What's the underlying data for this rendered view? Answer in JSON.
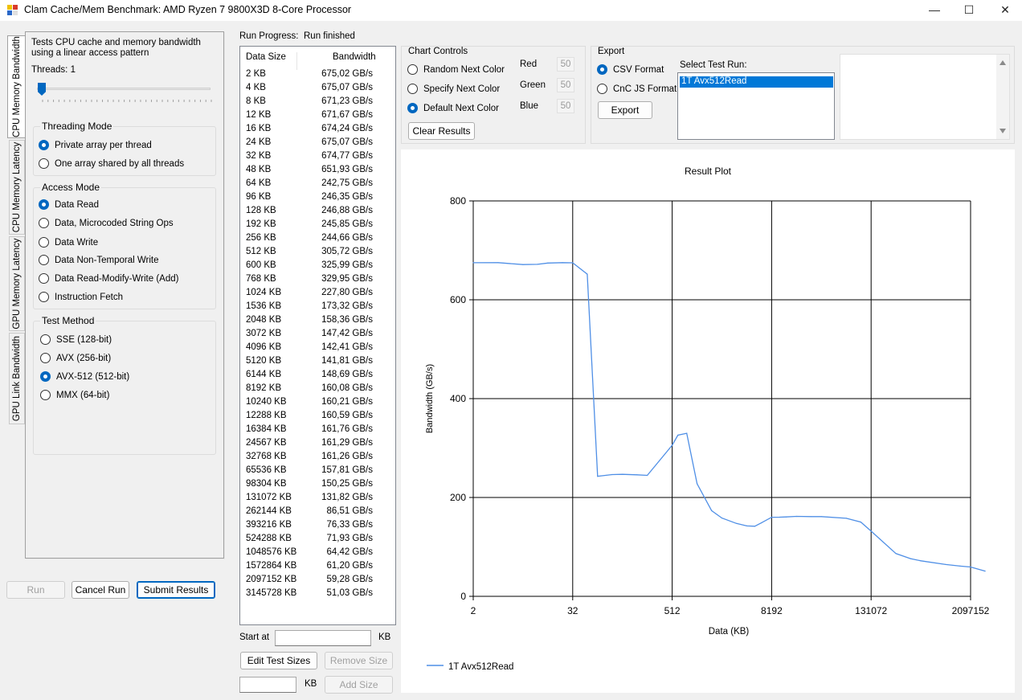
{
  "window": {
    "title": "Clam Cache/Mem Benchmark: AMD Ryzen 7 9800X3D 8-Core Processor"
  },
  "tabs": [
    {
      "label": "CPU Memory Bandwidth",
      "active": true
    },
    {
      "label": "CPU Memory Latency",
      "active": false
    },
    {
      "label": "GPU Memory Latency",
      "active": false
    },
    {
      "label": "GPU Link Bandwidth",
      "active": false
    }
  ],
  "left": {
    "description": "Tests CPU cache and memory bandwidth using a linear access pattern",
    "threads_label": "Threads: 1",
    "threads_value": 1,
    "threading_mode": {
      "title": "Threading Mode",
      "options": [
        {
          "label": "Private array per thread",
          "selected": true
        },
        {
          "label": "One array shared by all threads",
          "selected": false
        }
      ]
    },
    "access_mode": {
      "title": "Access Mode",
      "options": [
        {
          "label": "Data Read",
          "selected": true
        },
        {
          "label": "Data, Microcoded String Ops",
          "selected": false
        },
        {
          "label": "Data Write",
          "selected": false
        },
        {
          "label": "Data Non-Temporal Write",
          "selected": false
        },
        {
          "label": "Data Read-Modify-Write (Add)",
          "selected": false
        },
        {
          "label": "Instruction Fetch",
          "selected": false
        }
      ]
    },
    "test_method": {
      "title": "Test Method",
      "options": [
        {
          "label": "SSE (128-bit)",
          "selected": false
        },
        {
          "label": "AVX (256-bit)",
          "selected": false
        },
        {
          "label": "AVX-512 (512-bit)",
          "selected": true
        },
        {
          "label": "MMX (64-bit)",
          "selected": false
        }
      ]
    },
    "buttons": {
      "run": "Run",
      "cancel": "Cancel Run",
      "submit": "Submit Results"
    }
  },
  "progress": {
    "label": "Run Progress:",
    "status": "Run finished"
  },
  "results": {
    "columns": [
      "Data Size",
      "Bandwidth"
    ],
    "rows": [
      [
        "2 KB",
        "675,02 GB/s"
      ],
      [
        "4 KB",
        "675,07 GB/s"
      ],
      [
        "8 KB",
        "671,23 GB/s"
      ],
      [
        "12 KB",
        "671,67 GB/s"
      ],
      [
        "16 KB",
        "674,24 GB/s"
      ],
      [
        "24 KB",
        "675,07 GB/s"
      ],
      [
        "32 KB",
        "674,77 GB/s"
      ],
      [
        "48 KB",
        "651,93 GB/s"
      ],
      [
        "64 KB",
        "242,75 GB/s"
      ],
      [
        "96 KB",
        "246,35 GB/s"
      ],
      [
        "128 KB",
        "246,88 GB/s"
      ],
      [
        "192 KB",
        "245,85 GB/s"
      ],
      [
        "256 KB",
        "244,66 GB/s"
      ],
      [
        "512 KB",
        "305,72 GB/s"
      ],
      [
        "600 KB",
        "325,99 GB/s"
      ],
      [
        "768 KB",
        "329,95 GB/s"
      ],
      [
        "1024 KB",
        "227,80 GB/s"
      ],
      [
        "1536 KB",
        "173,32 GB/s"
      ],
      [
        "2048 KB",
        "158,36 GB/s"
      ],
      [
        "3072 KB",
        "147,42 GB/s"
      ],
      [
        "4096 KB",
        "142,41 GB/s"
      ],
      [
        "5120 KB",
        "141,81 GB/s"
      ],
      [
        "6144 KB",
        "148,69 GB/s"
      ],
      [
        "8192 KB",
        "160,08 GB/s"
      ],
      [
        "10240 KB",
        "160,21 GB/s"
      ],
      [
        "12288 KB",
        "160,59 GB/s"
      ],
      [
        "16384 KB",
        "161,76 GB/s"
      ],
      [
        "24567 KB",
        "161,29 GB/s"
      ],
      [
        "32768 KB",
        "161,26 GB/s"
      ],
      [
        "65536 KB",
        "157,81 GB/s"
      ],
      [
        "98304 KB",
        "150,25 GB/s"
      ],
      [
        "131072 KB",
        "131,82 GB/s"
      ],
      [
        "262144 KB",
        "86,51 GB/s"
      ],
      [
        "393216 KB",
        "76,33 GB/s"
      ],
      [
        "524288 KB",
        "71,93 GB/s"
      ],
      [
        "1048576 KB",
        "64,42 GB/s"
      ],
      [
        "1572864 KB",
        "61,20 GB/s"
      ],
      [
        "2097152 KB",
        "59,28 GB/s"
      ],
      [
        "3145728 KB",
        "51,03 GB/s"
      ]
    ]
  },
  "size_edit": {
    "start_at_label": "Start at",
    "start_at_value": "",
    "unit": "KB",
    "edit_button": "Edit Test Sizes",
    "remove_button": "Remove Size",
    "add_value": "",
    "add_unit": "KB",
    "add_button": "Add Size"
  },
  "chart_controls": {
    "title": "Chart Controls",
    "options": [
      {
        "label": "Random Next Color",
        "selected": false
      },
      {
        "label": "Specify Next Color",
        "selected": false
      },
      {
        "label": "Default Next Color",
        "selected": true
      }
    ],
    "color_fields": [
      {
        "label": "Red",
        "value": "50"
      },
      {
        "label": "Green",
        "value": "50"
      },
      {
        "label": "Blue",
        "value": "50"
      }
    ],
    "clear_button": "Clear Results"
  },
  "export": {
    "title": "Export",
    "formats": [
      {
        "label": "CSV Format",
        "selected": true
      },
      {
        "label": "CnC JS Format",
        "selected": false
      }
    ],
    "export_button": "Export",
    "select_run_label": "Select Test Run:",
    "runs": [
      "1T Avx512Read"
    ],
    "notes": ""
  },
  "colors": {
    "accent": "#0067c0",
    "series": "#4f8fe6",
    "selection": "#0078d7"
  },
  "chart_data": {
    "type": "line",
    "title": "Result Plot",
    "xlabel": "Data (KB)",
    "ylabel": "Bandwidth (GB/s)",
    "x_scale": "log2",
    "xlim": [
      2,
      2097152
    ],
    "ylim": [
      0,
      800
    ],
    "x_ticks": [
      "2",
      "32",
      "512",
      "8192",
      "131072",
      "2097152"
    ],
    "y_ticks": [
      "0",
      "200",
      "400",
      "600",
      "800"
    ],
    "grid": true,
    "legend": "bottom-left",
    "series": [
      {
        "name": "1T Avx512Read",
        "x": [
          2,
          4,
          8,
          12,
          16,
          24,
          32,
          48,
          64,
          96,
          128,
          192,
          256,
          512,
          600,
          768,
          1024,
          1536,
          2048,
          3072,
          4096,
          5120,
          6144,
          8192,
          10240,
          12288,
          16384,
          24567,
          32768,
          65536,
          98304,
          131072,
          262144,
          393216,
          524288,
          1048576,
          1572864,
          2097152,
          3145728
        ],
        "y": [
          675.02,
          675.07,
          671.23,
          671.67,
          674.24,
          675.07,
          674.77,
          651.93,
          242.75,
          246.35,
          246.88,
          245.85,
          244.66,
          305.72,
          325.99,
          329.95,
          227.8,
          173.32,
          158.36,
          147.42,
          142.41,
          141.81,
          148.69,
          160.08,
          160.21,
          160.59,
          161.76,
          161.29,
          161.26,
          157.81,
          150.25,
          131.82,
          86.51,
          76.33,
          71.93,
          64.42,
          61.2,
          59.28,
          51.03
        ]
      }
    ]
  }
}
